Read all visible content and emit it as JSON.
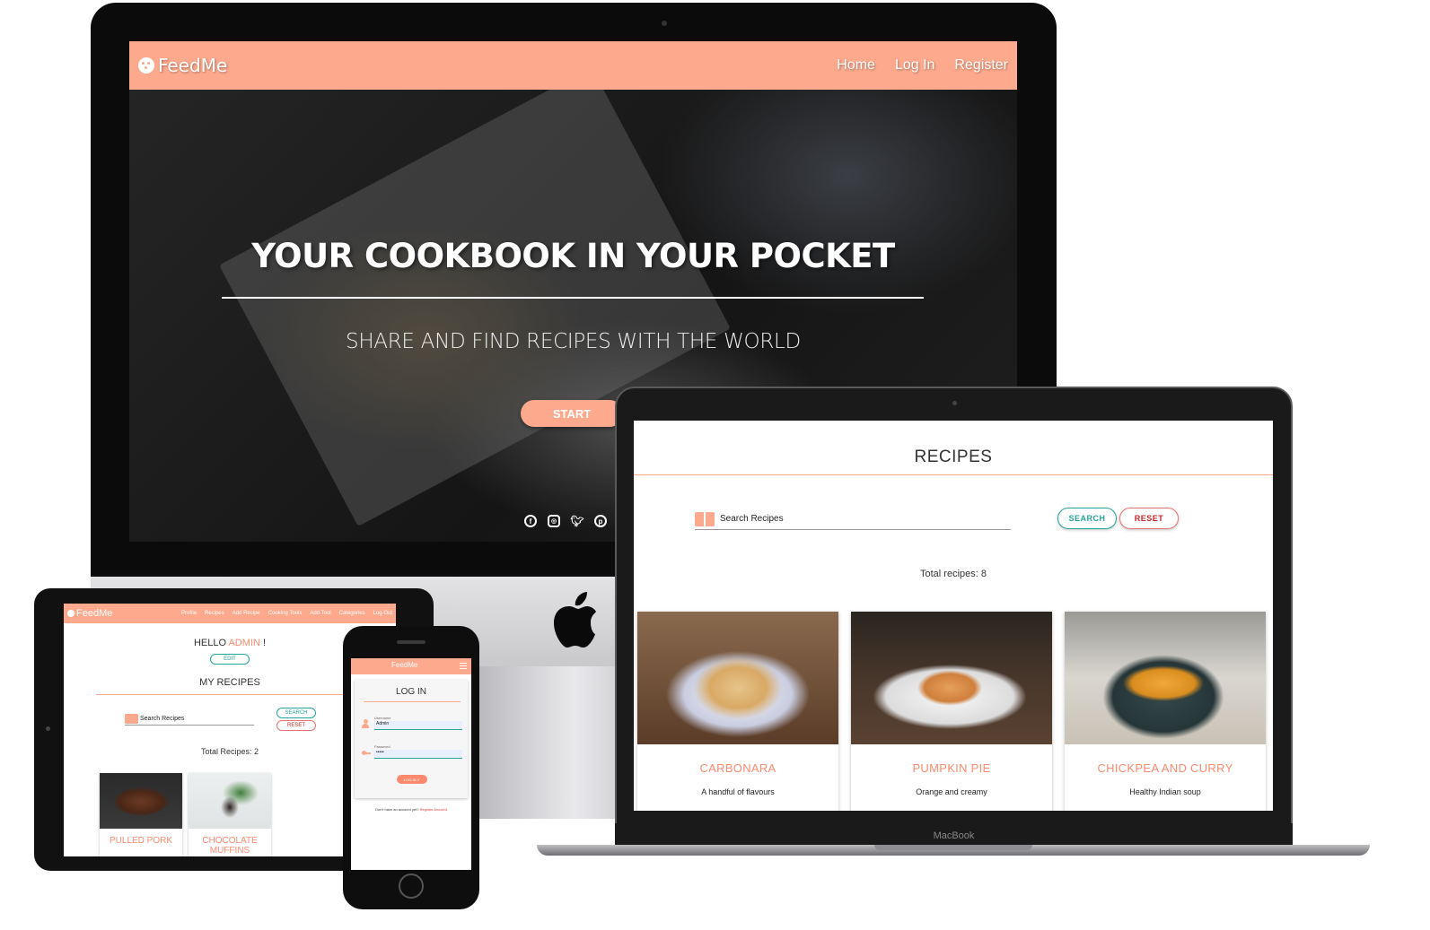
{
  "desktop": {
    "brand": "FeedMe",
    "nav": [
      "Home",
      "Log In",
      "Register"
    ],
    "hero_title": "YOUR COOKBOOK IN YOUR POCKET",
    "hero_subtitle": "SHARE AND FIND RECIPES WITH THE WORLD",
    "cta_label": "START",
    "social_icons": [
      "facebook-icon",
      "instagram-icon",
      "twitter-icon",
      "pinterest-icon"
    ]
  },
  "laptop": {
    "device_label": "MacBook",
    "page_title": "RECIPES",
    "search_placeholder": "Search Recipes",
    "search_button": "SEARCH",
    "reset_button": "RESET",
    "total_text": "Total recipes: 8",
    "recipes": [
      {
        "name": "CARBONARA",
        "description": "A handful of flavours"
      },
      {
        "name": "PUMPKIN PIE",
        "description": "Orange and creamy"
      },
      {
        "name": "CHICKPEA AND CURRY",
        "description": "Healthy Indian soup"
      }
    ]
  },
  "tablet": {
    "brand": "FeedMe",
    "nav": [
      "Profile",
      "Recipes",
      "Add Recipe",
      "Cooking Tools",
      "Add Tool",
      "Categories",
      "Log Out"
    ],
    "hello_prefix": "HELLO ",
    "hello_user": "ADMIN",
    "hello_suffix": " !",
    "edit_button": "EDIT",
    "section_title": "MY RECIPES",
    "search_placeholder": "Search Recipes",
    "search_button": "SEARCH",
    "reset_button": "RESET",
    "total_text": "Total Recipes: 2",
    "recipes": [
      {
        "name": "PULLED PORK"
      },
      {
        "name": "CHOCOLATE MUFFINS"
      }
    ]
  },
  "phone": {
    "brand": "FeedMe",
    "title": "LOG IN",
    "username_label": "Username",
    "username_value": "Admin",
    "password_label": "Password",
    "password_value": "•••••",
    "login_button": "LOG IN ✔",
    "footer_text": "Don't have an account yet? ",
    "footer_link": "Register Account"
  },
  "colors": {
    "brand_salmon": "#fda98d",
    "accent_text": "#fd8a6f",
    "teal": "#26a69a",
    "red": "#c62828"
  }
}
